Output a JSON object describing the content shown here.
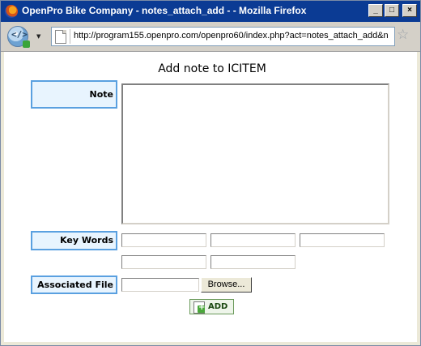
{
  "window": {
    "title": "OpenPro Bike Company - notes_attach_add - - Mozilla Firefox",
    "minimize_glyph": "_",
    "maximize_glyph": "□",
    "close_glyph": "×"
  },
  "navbar": {
    "url": "http://program155.openpro.com/openpro60/index.php?act=notes_attach_add&n",
    "icons": [
      "site-identity-icon",
      "page-icon",
      "bookmark-star-icon"
    ]
  },
  "form": {
    "heading": "Add note to ICITEM",
    "note_label": "Note",
    "note_value": "",
    "keywords_label": "Key Words",
    "keywords": [
      "",
      "",
      "",
      "",
      ""
    ],
    "file_label": "Associated File",
    "file_value": "",
    "browse_label": "Browse...",
    "add_label": "ADD"
  },
  "colors": {
    "label_bg": "#e8f4fe",
    "label_border": "#5aa0e0",
    "titlebar": "#0b3b94"
  }
}
